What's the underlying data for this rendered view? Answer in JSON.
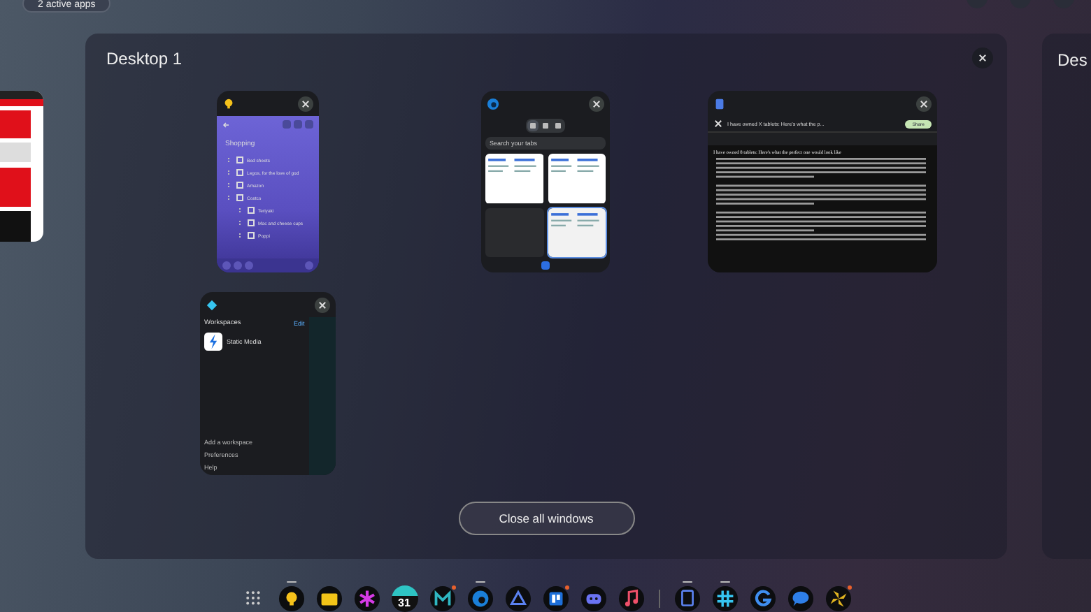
{
  "status": {
    "active_apps": "2 active apps"
  },
  "desktop": {
    "title": "Desktop 1",
    "windows": [
      {
        "kind": "notes",
        "title": "Shopping",
        "items": [
          {
            "text": "Bed sheets",
            "checked": false
          },
          {
            "text": "Legos, for the love of god",
            "checked": false
          },
          {
            "text": "Amazon",
            "checked": false
          },
          {
            "text": "Costco",
            "checked": false,
            "children": [
              {
                "text": "Teriyaki",
                "checked": false
              },
              {
                "text": "Mac and cheese cups",
                "checked": false
              },
              {
                "text": "Poppi",
                "checked": false
              }
            ]
          }
        ]
      },
      {
        "kind": "browser",
        "views": [
          {
            "selected": true
          },
          {
            "selected": false
          },
          {
            "selected": false
          }
        ],
        "search": "Search your tabs"
      },
      {
        "kind": "document",
        "title": "I have owned X tablets: Here's what the p...",
        "share": "Share",
        "heading": "I have owned 8 tablets: Here's what the perfect one would look like"
      },
      {
        "kind": "workspace",
        "title": "Workspaces",
        "edit": "Edit",
        "workspace": "Static Media",
        "links": [
          "Add a workspace",
          "Preferences",
          "Help"
        ]
      }
    ],
    "close_all": "Close all windows"
  },
  "next_desktop": {
    "title": "Des"
  },
  "dock": [
    {
      "kind": "apps",
      "running": false,
      "badge": false
    },
    {
      "kind": "keep",
      "running": true,
      "badge": false
    },
    {
      "kind": "files",
      "running": false,
      "badge": false
    },
    {
      "kind": "flower",
      "running": false,
      "badge": false
    },
    {
      "kind": "calendar",
      "label": "31",
      "running": false,
      "badge": false
    },
    {
      "kind": "m",
      "running": false,
      "badge": true
    },
    {
      "kind": "edge",
      "running": true,
      "badge": false
    },
    {
      "kind": "drive",
      "running": false,
      "badge": false
    },
    {
      "kind": "board",
      "running": false,
      "badge": true
    },
    {
      "kind": "discord",
      "running": false,
      "badge": false
    },
    {
      "kind": "music",
      "running": false,
      "badge": false
    },
    {
      "kind": "divider"
    },
    {
      "kind": "docs",
      "running": true,
      "badge": false
    },
    {
      "kind": "slack",
      "running": true,
      "badge": false
    },
    {
      "kind": "g",
      "running": false,
      "badge": false
    },
    {
      "kind": "chat",
      "running": false,
      "badge": false
    },
    {
      "kind": "pinwheel",
      "running": false,
      "badge": true
    }
  ]
}
